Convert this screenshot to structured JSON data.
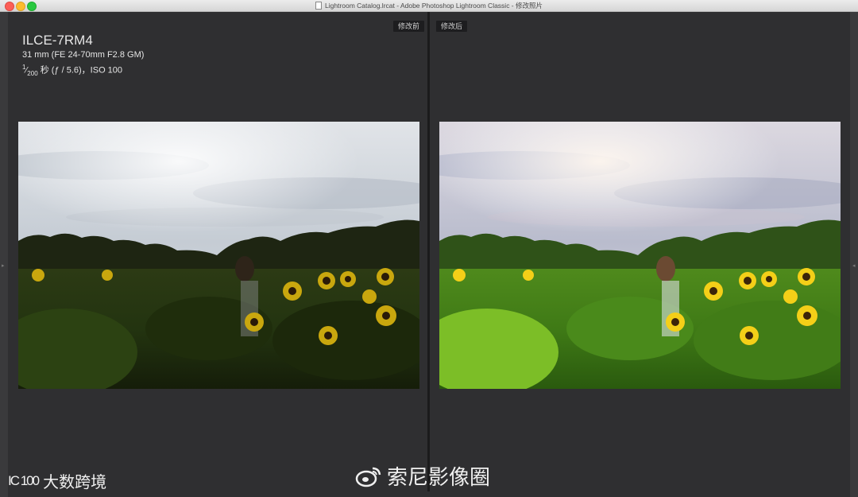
{
  "window": {
    "title": "Lightroom Catalog.lrcat - Adobe Photoshop Lightroom Classic - 修改照片"
  },
  "info": {
    "camera": "ILCE-7RM4",
    "lens": "31 mm (FE 24-70mm F2.8 GM)",
    "shutter_numerator": "1",
    "shutter_denominator": "200",
    "exposure_rest": "秒 (ƒ / 5.6)，ISO 100"
  },
  "labels": {
    "before": "修改前",
    "after": "修改后"
  },
  "watermarks": {
    "left_logo": "IC 100",
    "left_text": "大数跨境",
    "right_text": "索尼影像圈"
  },
  "colors": {
    "background": "#2e2e30",
    "panel": "#2f2f31",
    "label_bg": "#1d1d1f"
  },
  "icons": {
    "close": "traffic-light-close",
    "minimize": "traffic-light-minimize",
    "maximize": "traffic-light-maximize",
    "document": "document-icon",
    "weibo": "weibo-icon"
  }
}
